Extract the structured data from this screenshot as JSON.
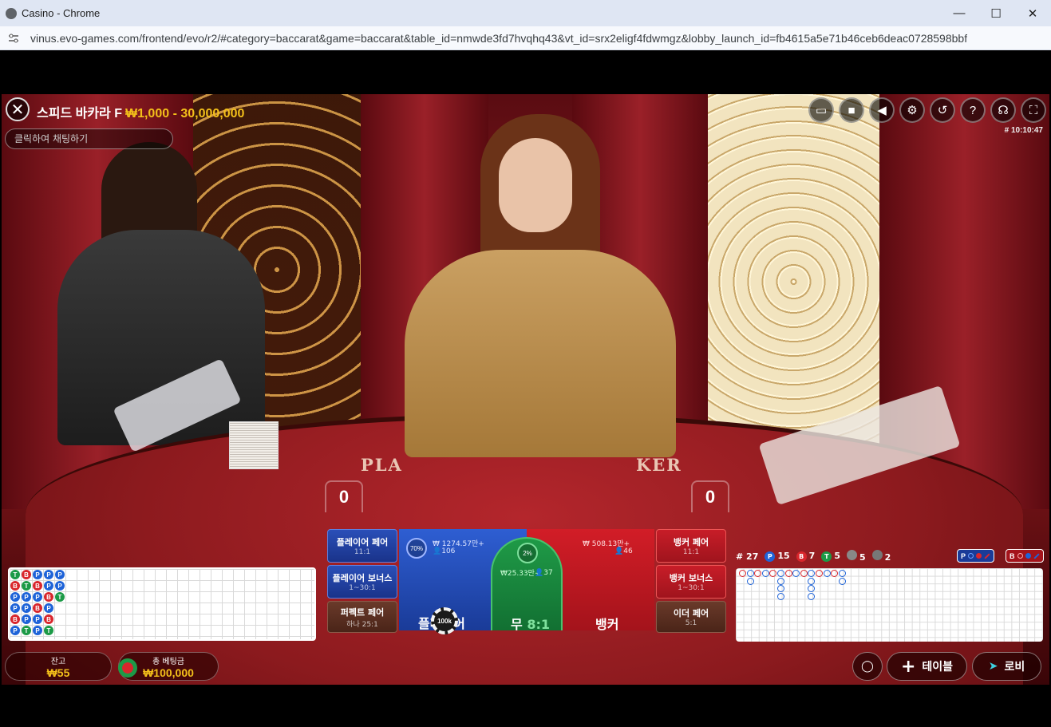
{
  "window": {
    "title": "Casino - Chrome",
    "url": "vinus.evo-games.com/frontend/evo/r2/#category=baccarat&game=baccarat&table_id=nmwde3fd7hvqhq43&vt_id=srx2eligf4fdwmgz&lobby_launch_id=fb4615a5e71b46ceb6deac0728598bbf"
  },
  "game": {
    "table_name": "스피드 바카라 F",
    "limits": "₩1,000 - 30,000,000",
    "chat_placeholder": "클릭하여 채팅하기",
    "round_id": "# 10:10:47",
    "player_score": "0",
    "banker_score": "0",
    "felt_player": "PLA",
    "felt_banker": "KER"
  },
  "side_bets_left": [
    {
      "label": "플레이어 페어",
      "payout": "11:1"
    },
    {
      "label": "플레이어 보너스",
      "payout": "1~30:1"
    },
    {
      "label": "퍼펙트 페어",
      "payout": "하나 25:1"
    }
  ],
  "side_bets_right": [
    {
      "label": "뱅커 페어",
      "payout": "11:1"
    },
    {
      "label": "뱅커 보너스",
      "payout": "1~30:1"
    },
    {
      "label": "이더 페어",
      "payout": "5:1"
    }
  ],
  "main_bets": {
    "player": {
      "label": "플레이어",
      "pct": "70%",
      "amount": "₩ 1274.57만+",
      "players": "106"
    },
    "tie": {
      "label": "무",
      "payout": "8:1",
      "pct": "2%",
      "amount": "₩25.33만+",
      "players": "37"
    },
    "banker": {
      "label": "뱅커",
      "amount": "₩ 508.13만+",
      "players": "46"
    },
    "chip_value": "100k"
  },
  "stats": {
    "round": "# 27",
    "player": "15",
    "banker": "7",
    "tie": "5",
    "p_pair": "5",
    "b_pair": "2"
  },
  "predict": {
    "player": "P",
    "banker": "B"
  },
  "bead_road": [
    [
      "T",
      "B",
      "P",
      "P",
      "P"
    ],
    [
      "B",
      "T",
      "B",
      "P",
      "P"
    ],
    [
      "P",
      "P",
      "P",
      "B",
      "T"
    ],
    [
      "P",
      "P",
      "B",
      "P",
      ""
    ],
    [
      "B",
      "P",
      "P",
      "B",
      ""
    ],
    [
      "P",
      "T",
      "P",
      "T",
      ""
    ]
  ],
  "bottom": {
    "balance_label": "잔고",
    "balance": "₩55",
    "total_bet_label": "총 베팅금",
    "total_bet": "₩100,000",
    "tables_label": "테이블",
    "lobby_label": "로비"
  },
  "colors": {
    "player": "#1e63d8",
    "banker": "#d9262c",
    "tie": "#1c9a47",
    "gold": "#f3c01a"
  }
}
